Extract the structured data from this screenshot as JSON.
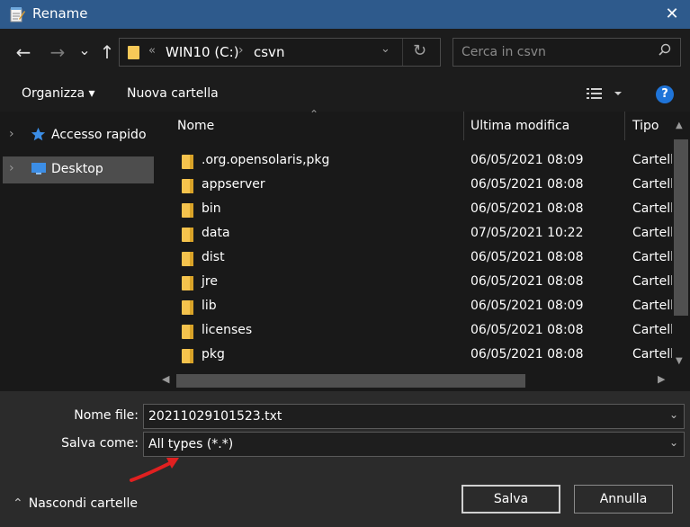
{
  "window": {
    "title": "Rename",
    "close_label": "✕"
  },
  "nav": {
    "back": "←",
    "forward": "→",
    "recent": "⌄",
    "up": "↑",
    "address": {
      "separator": "«",
      "crumbs": [
        "WIN10 (C:)",
        "csvn"
      ],
      "chevron": "›"
    },
    "search_placeholder": "Cerca in csvn"
  },
  "toolbar": {
    "organize_label": "Organizza ▾",
    "new_folder_label": "Nuova cartella",
    "help_label": "?"
  },
  "sidebar": {
    "items": [
      {
        "label": "Accesso rapido",
        "icon": "star-icon",
        "color": "#3c8ee6"
      },
      {
        "label": "Desktop",
        "icon": "desktop-icon",
        "color": "#3c8ee6"
      }
    ]
  },
  "filelist": {
    "columns": [
      "Nome",
      "Ultima modifica",
      "Tipo"
    ],
    "rows": [
      {
        "name": ".org.opensolaris,pkg",
        "date": "06/05/2021 08:09",
        "type": "Cartell"
      },
      {
        "name": "appserver",
        "date": "06/05/2021 08:08",
        "type": "Cartell"
      },
      {
        "name": "bin",
        "date": "06/05/2021 08:08",
        "type": "Cartell"
      },
      {
        "name": "data",
        "date": "07/05/2021 10:22",
        "type": "Cartell"
      },
      {
        "name": "dist",
        "date": "06/05/2021 08:08",
        "type": "Cartell"
      },
      {
        "name": "jre",
        "date": "06/05/2021 08:08",
        "type": "Cartell"
      },
      {
        "name": "lib",
        "date": "06/05/2021 08:09",
        "type": "Cartell"
      },
      {
        "name": "licenses",
        "date": "06/05/2021 08:08",
        "type": "Cartell"
      },
      {
        "name": "pkg",
        "date": "06/05/2021 08:08",
        "type": "Cartell"
      }
    ]
  },
  "form": {
    "filename_label": "Nome file:",
    "filename_value": "20211029101523.txt",
    "savetype_label": "Salva come:",
    "savetype_value": "All types (*.*)"
  },
  "footer": {
    "hide_folders_label": "Nascondi cartelle",
    "save_label": "Salva",
    "cancel_label": "Annulla"
  },
  "colors": {
    "titlebar": "#2e5a8c",
    "annotation_arrow": "#e02020",
    "folder": "#f5c34d"
  }
}
